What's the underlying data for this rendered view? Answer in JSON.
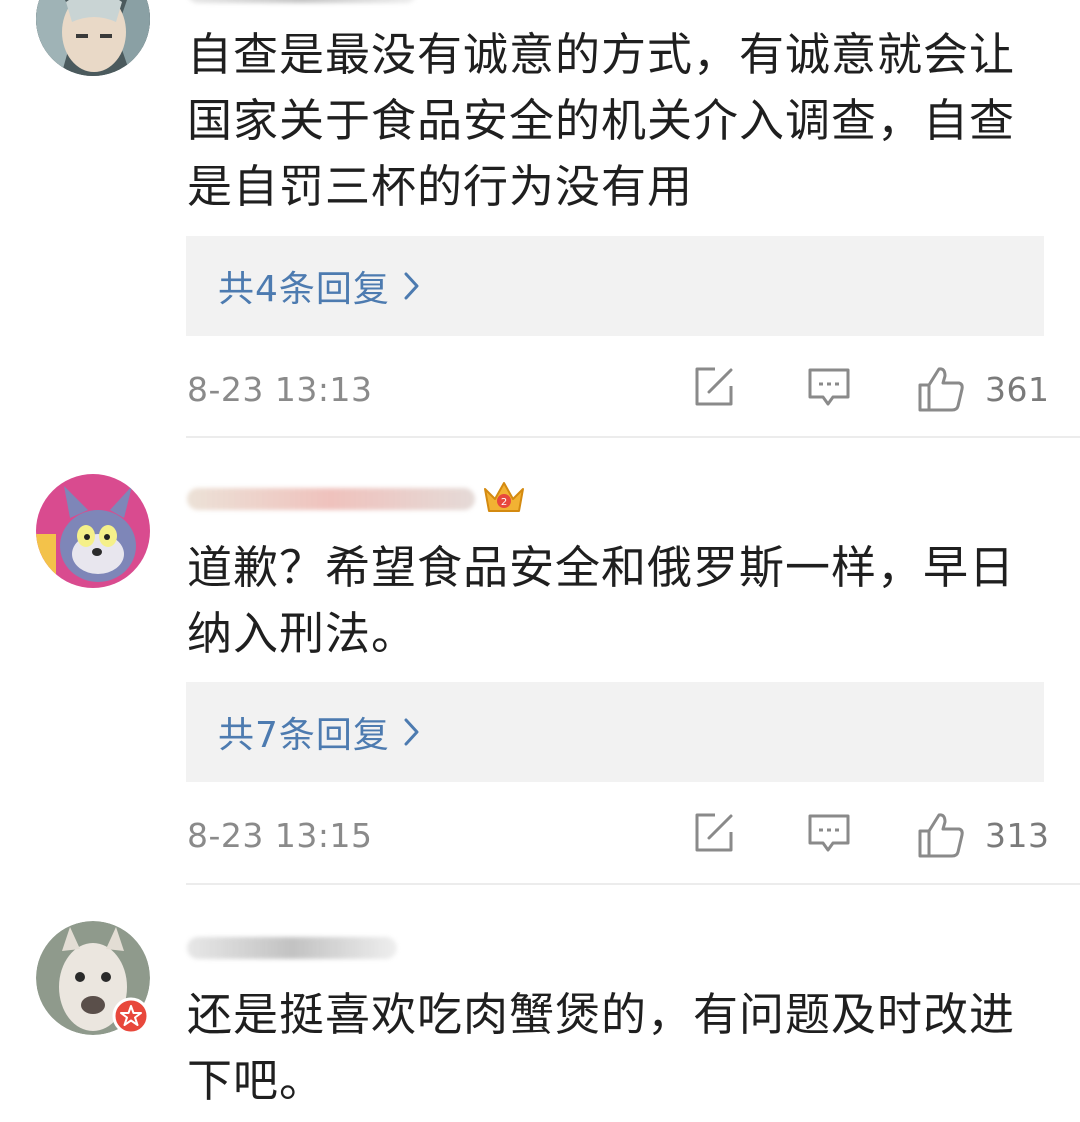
{
  "comments": [
    {
      "text": "自查是最没有诚意的方式，有诚意就会让国家关于食品安全的机关介入调查，自查是自罚三杯的行为没有用",
      "replies_label": "共4条回复",
      "timestamp": "8-23 13:13",
      "likes": "361"
    },
    {
      "text": "道歉？希望食品安全和俄罗斯一样，早日纳入刑法。",
      "replies_label": "共7条回复",
      "timestamp": "8-23 13:15",
      "likes": "313"
    },
    {
      "text": "还是挺喜欢吃肉蟹煲的，有问题及时改进下吧。"
    }
  ],
  "icons": {
    "reply_chevron": "chevron-right-icon",
    "repost": "repost-edit-icon",
    "comment": "comment-bubble-icon",
    "like": "thumbs-up-icon",
    "crown_badge": "crown-badge-icon",
    "verified_badge": "verified-badge-icon"
  },
  "colors": {
    "link": "#4d7bb0",
    "reply_box_bg": "#f2f2f2",
    "meta_text": "#8a8a8a",
    "badge_red": "#e8483c",
    "crown_gold": "#f2b233"
  }
}
